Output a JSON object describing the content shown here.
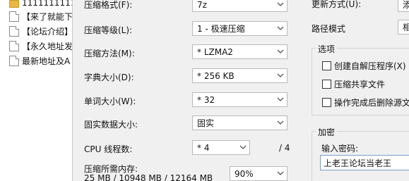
{
  "file_list": [
    {
      "icon": "folder-icon",
      "name": "11111111111"
    },
    {
      "icon": "document-icon",
      "name": "【来了就能下"
    },
    {
      "icon": "document-icon",
      "name": "【论坛介绍】"
    },
    {
      "icon": "document-icon",
      "name": "【永久地址发"
    },
    {
      "icon": "document-icon",
      "name": "最新地址及A"
    }
  ],
  "dialog": {
    "format": {
      "label": "压缩格式(F):",
      "value": "7z"
    },
    "level": {
      "label": "压缩等级(L):",
      "value": "1 - 极速压缩"
    },
    "method": {
      "label": "压缩方法(M):",
      "value": "* LZMA2"
    },
    "dict": {
      "label": "字典大小(D):",
      "value": "* 256 KB"
    },
    "word": {
      "label": "单词大小(W):",
      "value": "* 32"
    },
    "solid": {
      "label": "固实数据大小:",
      "value": "固实"
    },
    "threads": {
      "label": "CPU 线程数:",
      "value": "* 4",
      "total": "/ 4"
    },
    "memory": {
      "label": "压缩所需内存:",
      "value": "25 MB / 10948 MB / 12164 MB",
      "percent": "90%"
    },
    "update": {
      "label": "更新方式(U):",
      "value": "添"
    },
    "path_mode": {
      "label": "路径模式",
      "value": "相"
    },
    "options": {
      "title": "选项",
      "items": [
        {
          "label": "创建自解压程序(X)",
          "checked": false
        },
        {
          "label": "压缩共享文件",
          "checked": false
        },
        {
          "label": "操作完成后删除源文",
          "checked": false
        }
      ]
    },
    "encryption": {
      "title": "加密",
      "password_label": "输入密码:",
      "password_value": "上老王论坛当老王"
    }
  }
}
